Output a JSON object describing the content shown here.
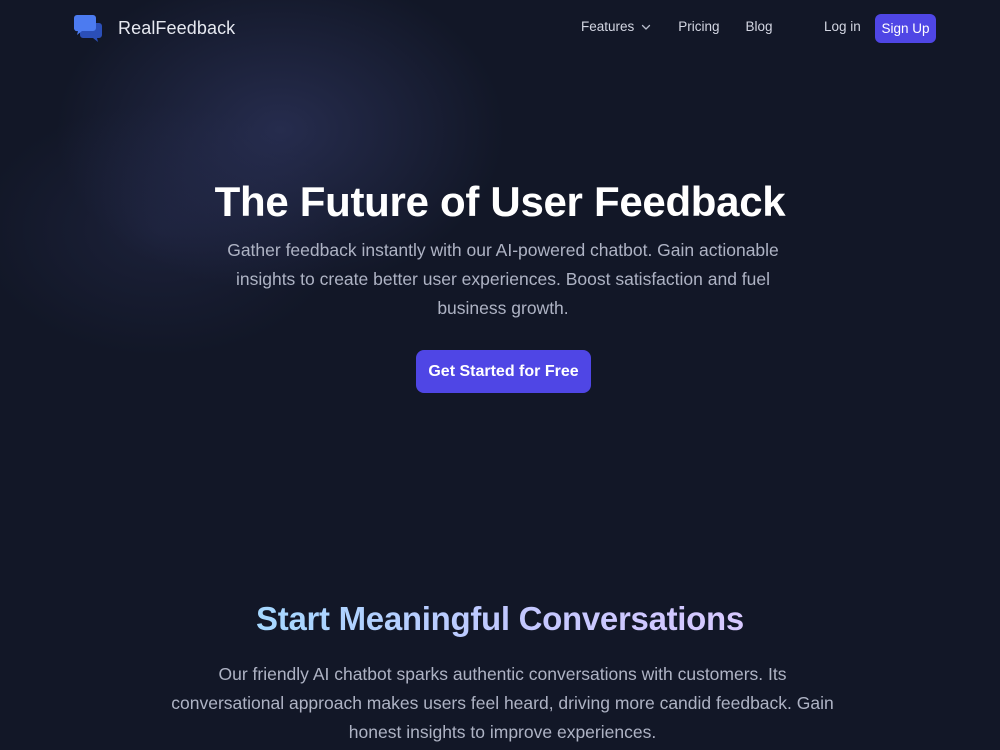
{
  "header": {
    "logo_icon": "chat-bubbles-icon",
    "brand_name": "RealFeedback",
    "nav": {
      "features_label": "Features",
      "features_icon": "chevron-down-icon",
      "pricing_label": "Pricing",
      "blog_label": "Blog"
    },
    "login_label": "Log in",
    "signup_label": "Sign Up"
  },
  "hero": {
    "title": "The Future of User Feedback",
    "subtitle": "Gather feedback instantly with our AI-powered chatbot. Gain actionable insights to create better user experiences. Boost satisfaction and fuel business growth.",
    "cta_label": "Get Started for Free"
  },
  "conversations": {
    "title": "Start Meaningful Conversations",
    "description": "Our friendly AI chatbot sparks authentic conversations with customers. Its conversational approach makes users feel heard, driving more candid feedback. Gain honest insights to improve experiences."
  },
  "colors": {
    "background": "#121727",
    "accent": "#4f46e5",
    "logo_primary": "#4c7bf0",
    "logo_secondary": "#2b4fb8"
  }
}
